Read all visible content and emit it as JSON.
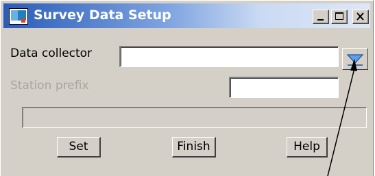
{
  "window": {
    "title": "Survey Data Setup",
    "app_icon": "window-app-icon",
    "controls": {
      "minimize_icon": "minimize-icon",
      "maximize_icon": "maximize-icon",
      "close_icon": "close-icon"
    }
  },
  "form": {
    "data_collector": {
      "label": "Data collector",
      "value": "",
      "dropdown_icon": "chevron-down-icon"
    },
    "station_prefix": {
      "label": "Station prefix",
      "value": "",
      "enabled": false
    },
    "status_bar": {
      "text": ""
    }
  },
  "buttons": {
    "set": "Set",
    "finish": "Finish",
    "help": "Help"
  },
  "colors": {
    "face": "#d4d0c8",
    "disabled_text": "#a8a6a0",
    "dropdown_arrow": "#4a90d9"
  }
}
